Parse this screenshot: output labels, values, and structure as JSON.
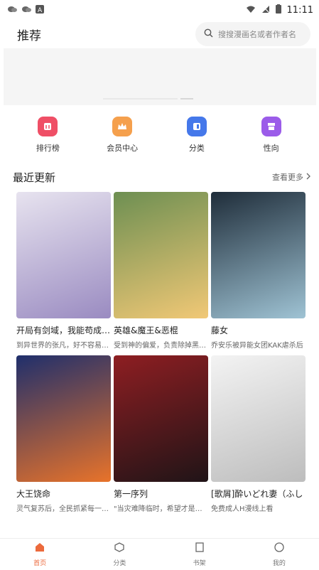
{
  "status": {
    "time": "11:11"
  },
  "header": {
    "title": "推荐",
    "search_placeholder": "搜搜漫画名或者作者名"
  },
  "categories": [
    {
      "label": "排行榜",
      "color": "#ef4f66"
    },
    {
      "label": "会员中心",
      "color": "#f5a04d"
    },
    {
      "label": "分类",
      "color": "#4578ea"
    },
    {
      "label": "性向",
      "color": "#9b5ce9"
    }
  ],
  "section": {
    "title": "最近更新",
    "more_label": "查看更多"
  },
  "comics": [
    {
      "name": "开局有剑域，我能苟成剑神",
      "desc": "到异世界的张凡，好不容易成了",
      "colors": [
        "#e7e3ef",
        "#9a8bc1"
      ]
    },
    {
      "name": "英雄&魔王&恶棍",
      "desc": "受到神的偏爱，负责除掉黑魔王",
      "colors": [
        "#6d8f52",
        "#f1c876"
      ]
    },
    {
      "name": "藤女",
      "desc": "乔安乐被异能女团KAK虐杀后",
      "colors": [
        "#1f2d3a",
        "#9fc3d4"
      ]
    },
    {
      "name": "大王饶命",
      "desc": "灵气复苏后，全民抓紧每一分秒",
      "colors": [
        "#1f2f6c",
        "#e8732a"
      ]
    },
    {
      "name": "第一序列",
      "desc": "\"当灾难降临时，希望才是最珍",
      "colors": [
        "#8e1e22",
        "#201417"
      ]
    },
    {
      "name": "[歌屑]酔いどれ妻（ふし",
      "desc": "免费成人H漫线上看",
      "colors": [
        "#f3f3f3",
        "#bdbdbd"
      ]
    }
  ],
  "tabs": [
    {
      "label": "首页",
      "active": true
    },
    {
      "label": "分类",
      "active": false
    },
    {
      "label": "书架",
      "active": false
    },
    {
      "label": "我的",
      "active": false
    }
  ]
}
